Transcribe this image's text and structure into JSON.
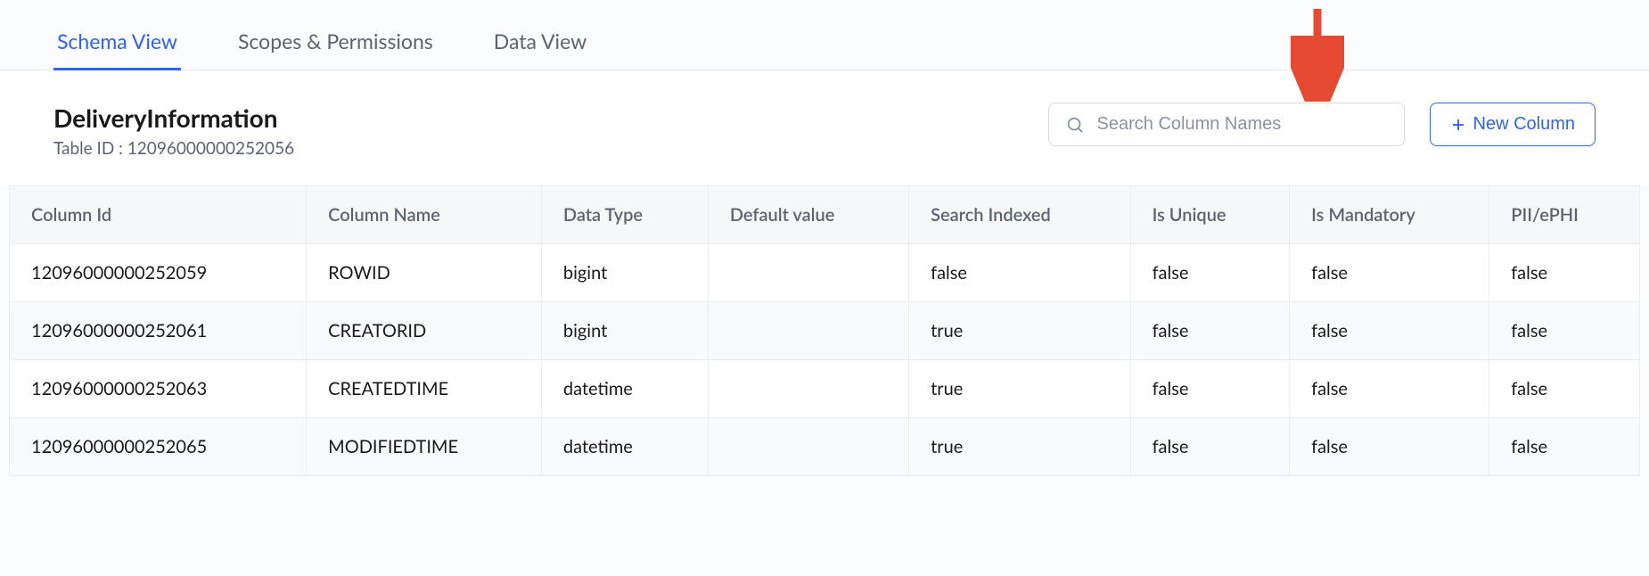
{
  "tabs": [
    {
      "label": "Schema View",
      "active": true
    },
    {
      "label": "Scopes & Permissions",
      "active": false
    },
    {
      "label": "Data View",
      "active": false
    }
  ],
  "header": {
    "table_name": "DeliveryInformation",
    "table_id_label": "Table ID : 12096000000252056"
  },
  "search": {
    "placeholder": "Search Column Names"
  },
  "new_column_button": {
    "label": "New Column"
  },
  "table": {
    "headers": [
      "Column Id",
      "Column Name",
      "Data Type",
      "Default value",
      "Search Indexed",
      "Is Unique",
      "Is Mandatory",
      "PII/ePHI"
    ],
    "rows": [
      {
        "cells": [
          "12096000000252059",
          "ROWID",
          "bigint",
          "",
          "false",
          "false",
          "false",
          "false"
        ]
      },
      {
        "cells": [
          "12096000000252061",
          "CREATORID",
          "bigint",
          "",
          "true",
          "false",
          "false",
          "false"
        ]
      },
      {
        "cells": [
          "12096000000252063",
          "CREATEDTIME",
          "datetime",
          "",
          "true",
          "false",
          "false",
          "false"
        ]
      },
      {
        "cells": [
          "12096000000252065",
          "MODIFIEDTIME",
          "datetime",
          "",
          "true",
          "false",
          "false",
          "false"
        ]
      }
    ]
  },
  "annotation": {
    "arrow_color": "#e64a33"
  }
}
